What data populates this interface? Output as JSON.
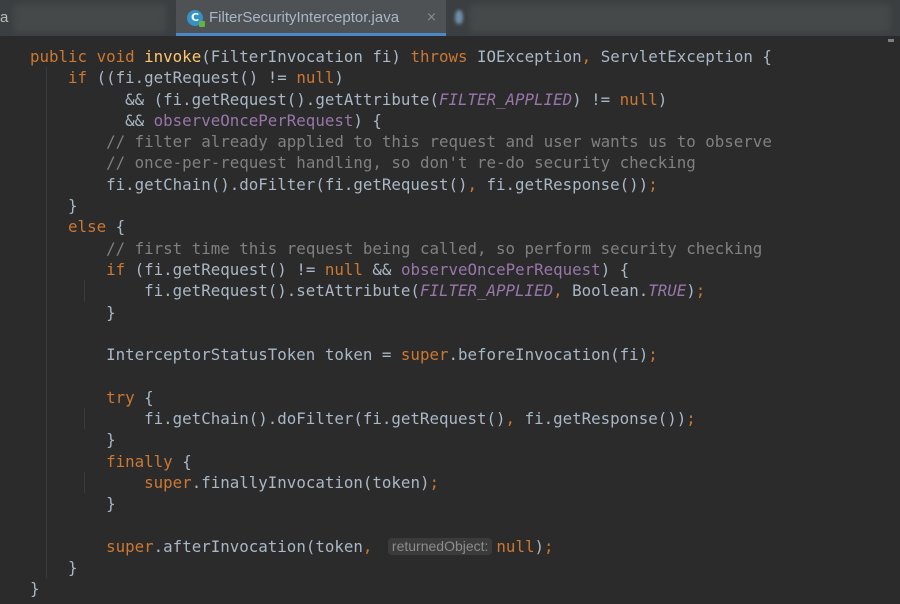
{
  "tabs": {
    "left_fragment": "a",
    "active_label": "FilterSecurityInterceptor.java",
    "close_glyph": "×",
    "active_icon": "java-class-icon",
    "icon_letter": "C"
  },
  "colors": {
    "background": "#2b2b2b",
    "tabbar": "#3c3f41",
    "active_tab": "#4e5254",
    "active_tab_underline": "#4a88c7",
    "keyword": "#cc7832",
    "method_declaration": "#ffc66d",
    "constant_field": "#9876aa",
    "comment": "#808080",
    "plain_text": "#a9b7c6"
  },
  "code": [
    [
      [
        "kw",
        "public void "
      ],
      [
        "method",
        "invoke"
      ],
      [
        "plain",
        "(FilterInvocation fi) "
      ],
      [
        "kw",
        "throws "
      ],
      [
        "plain",
        "IOException"
      ],
      [
        "kw",
        ", "
      ],
      [
        "plain",
        "ServletException {"
      ]
    ],
    [
      [
        "plain",
        "    "
      ],
      [
        "kw",
        "if "
      ],
      [
        "plain",
        "((fi.getRequest() != "
      ],
      [
        "kw",
        "null"
      ],
      [
        "plain",
        ")"
      ]
    ],
    [
      [
        "plain",
        "          && (fi.getRequest().getAttribute("
      ],
      [
        "const",
        "FILTER_APPLIED"
      ],
      [
        "plain",
        ") != "
      ],
      [
        "kw",
        "null"
      ],
      [
        "plain",
        ")"
      ]
    ],
    [
      [
        "plain",
        "          && "
      ],
      [
        "field",
        "observeOncePerRequest"
      ],
      [
        "plain",
        ") {"
      ]
    ],
    [
      [
        "plain",
        "        "
      ],
      [
        "comment",
        "// filter already applied to this request and user wants us to observe"
      ]
    ],
    [
      [
        "plain",
        "        "
      ],
      [
        "comment",
        "// once-per-request handling, so don't re-do security checking"
      ]
    ],
    [
      [
        "plain",
        "        fi.getChain().doFilter(fi.getRequest()"
      ],
      [
        "kw",
        ", "
      ],
      [
        "plain",
        "fi.getResponse())"
      ],
      [
        "kw",
        ";"
      ]
    ],
    [
      [
        "plain",
        "    }"
      ]
    ],
    [
      [
        "plain",
        "    "
      ],
      [
        "kw",
        "else "
      ],
      [
        "plain",
        "{"
      ]
    ],
    [
      [
        "plain",
        "        "
      ],
      [
        "comment",
        "// first time this request being called, so perform security checking"
      ]
    ],
    [
      [
        "plain",
        "        "
      ],
      [
        "kw",
        "if "
      ],
      [
        "plain",
        "(fi.getRequest() != "
      ],
      [
        "kw",
        "null "
      ],
      [
        "plain",
        "&& "
      ],
      [
        "field",
        "observeOncePerRequest"
      ],
      [
        "plain",
        ") {"
      ]
    ],
    [
      [
        "plain",
        "            fi.getRequest().setAttribute("
      ],
      [
        "const",
        "FILTER_APPLIED"
      ],
      [
        "kw",
        ", "
      ],
      [
        "plain",
        "Boolean."
      ],
      [
        "const",
        "TRUE"
      ],
      [
        "plain",
        ")"
      ],
      [
        "kw",
        ";"
      ]
    ],
    [
      [
        "plain",
        "        }"
      ]
    ],
    [],
    [
      [
        "plain",
        "        InterceptorStatusToken token = "
      ],
      [
        "kw",
        "super"
      ],
      [
        "plain",
        ".beforeInvocation(fi)"
      ],
      [
        "kw",
        ";"
      ]
    ],
    [],
    [
      [
        "plain",
        "        "
      ],
      [
        "kw",
        "try "
      ],
      [
        "plain",
        "{"
      ]
    ],
    [
      [
        "plain",
        "            fi.getChain().doFilter(fi.getRequest()"
      ],
      [
        "kw",
        ", "
      ],
      [
        "plain",
        "fi.getResponse())"
      ],
      [
        "kw",
        ";"
      ]
    ],
    [
      [
        "plain",
        "        }"
      ]
    ],
    [
      [
        "plain",
        "        "
      ],
      [
        "kw",
        "finally "
      ],
      [
        "plain",
        "{"
      ]
    ],
    [
      [
        "plain",
        "            "
      ],
      [
        "kw",
        "super"
      ],
      [
        "plain",
        ".finallyInvocation(token)"
      ],
      [
        "kw",
        ";"
      ]
    ],
    [
      [
        "plain",
        "        }"
      ]
    ],
    [],
    [
      [
        "plain",
        "        "
      ],
      [
        "kw",
        "super"
      ],
      [
        "plain",
        ".afterInvocation(token"
      ],
      [
        "kw",
        ", "
      ],
      [
        "hint",
        "returnedObject:"
      ],
      [
        "kw",
        "null"
      ],
      [
        "plain",
        ")"
      ],
      [
        "kw",
        ";"
      ]
    ],
    [
      [
        "plain",
        "    }"
      ]
    ],
    [
      [
        "plain",
        "}"
      ]
    ]
  ]
}
